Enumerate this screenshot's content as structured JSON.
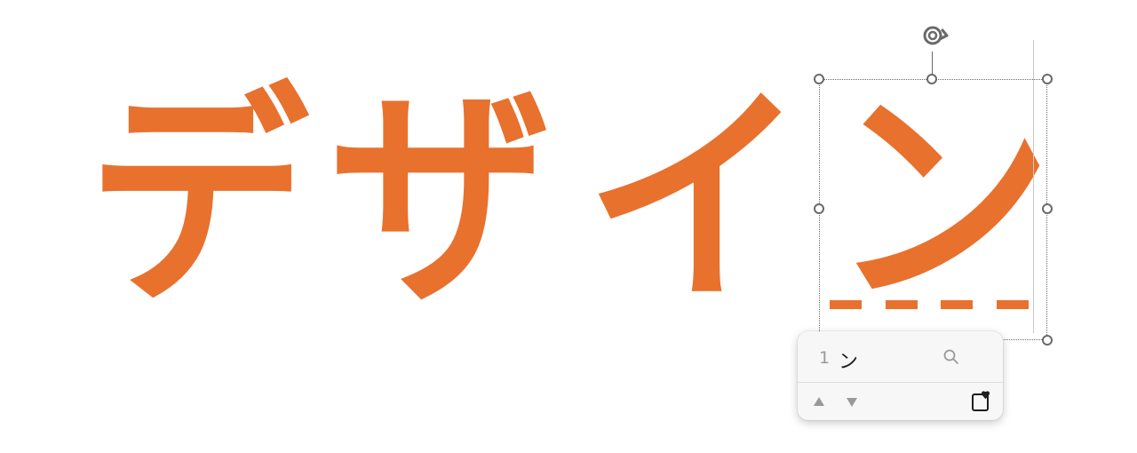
{
  "theme": {
    "accent": "#E8712E",
    "handle_color": "#6a6a6a"
  },
  "canvas_text": {
    "characters": [
      "デ",
      "ザ",
      "イ",
      "ン"
    ],
    "selected_character": "ン"
  },
  "ime_candidate": {
    "number": "1",
    "text": "ン",
    "icons": {
      "search": "search-icon",
      "prev": "triangle-up-icon",
      "next": "triangle-down-icon",
      "favorite": "heart-bookmark-icon"
    }
  }
}
